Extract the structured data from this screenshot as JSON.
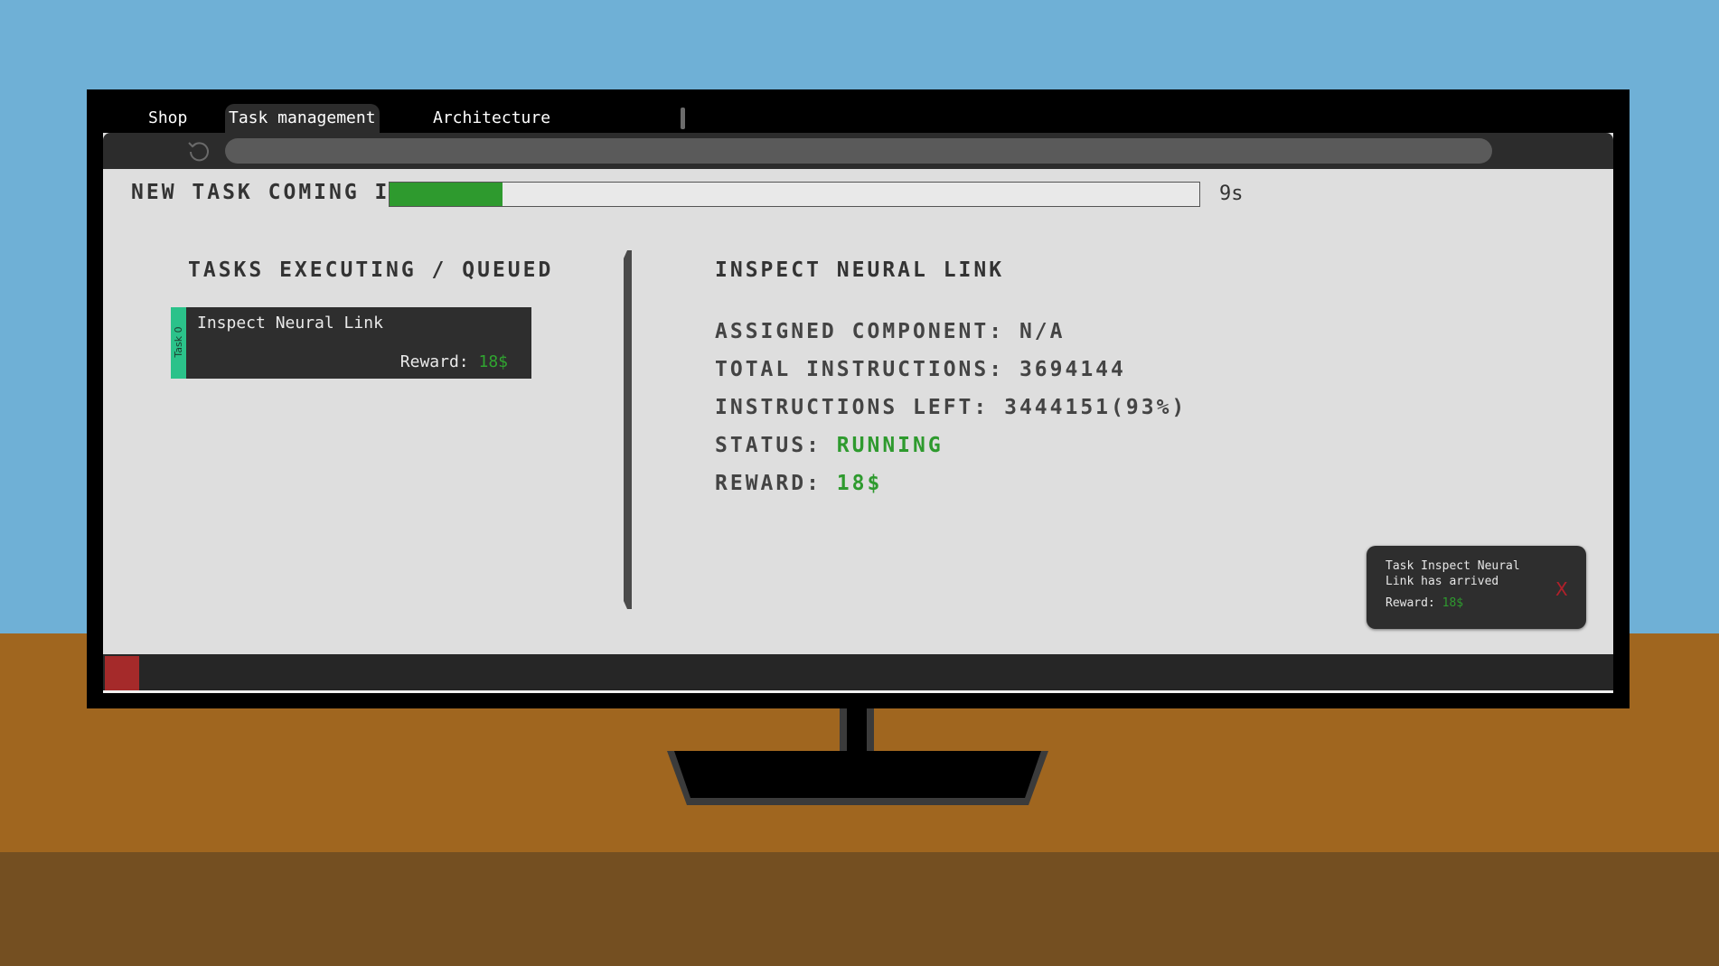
{
  "tabs": [
    {
      "label": "Shop"
    },
    {
      "label": "Task management",
      "active": true
    },
    {
      "label": "Architecture"
    }
  ],
  "countdown": {
    "label": "NEW TASK COMING IN",
    "progress_fraction": 0.14,
    "seconds_label": "9s",
    "color": "#2e9a2e"
  },
  "queue": {
    "title": "TASKS EXECUTING / QUEUED",
    "items": [
      {
        "id_label": "Task 0",
        "name": "Inspect Neural Link",
        "reward_label": "Reward:",
        "reward_value": "18$",
        "stripe_color": "#2bc28a"
      }
    ]
  },
  "details": {
    "title": "INSPECT NEURAL LINK",
    "assigned_component": "ASSIGNED COMPONENT: N/A",
    "total_instructions": "TOTAL INSTRUCTIONS: 3694144",
    "instructions_left": "INSTRUCTIONS LEFT: 3444151(93%)",
    "status_label": "STATUS:",
    "status_value": "RUNNING",
    "reward_label": "REWARD:",
    "reward_value": "18$"
  },
  "notification": {
    "message": "Task Inspect Neural Link has arrived",
    "reward_label": "Reward:",
    "reward_value": "18$",
    "close_label": "X"
  },
  "icons": {
    "reload": "reload-icon",
    "close": "close-icon",
    "start": "start-button"
  },
  "colors": {
    "sky": "#6fb0d6",
    "desk": "#a0661f",
    "accent_green": "#2e9a2e",
    "close_red": "#b0202a",
    "start_red": "#a52a2a"
  }
}
